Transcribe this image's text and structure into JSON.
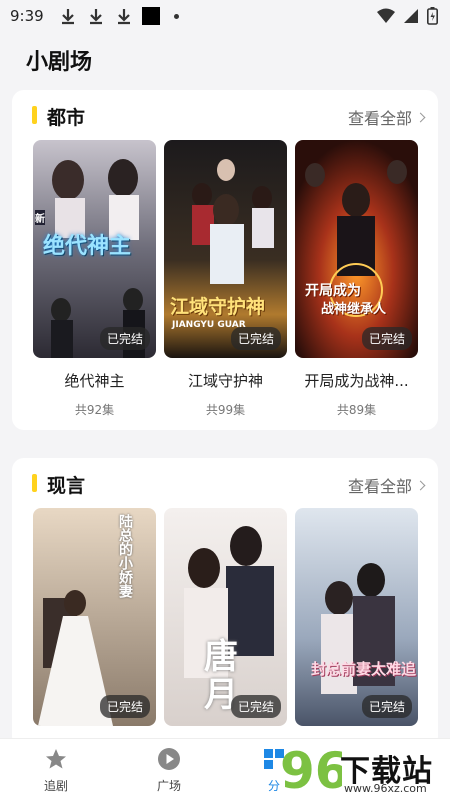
{
  "status_bar": {
    "time": "9:39"
  },
  "page_title": "小剧场",
  "sections": [
    {
      "title": "都市",
      "more_label": "查看全部",
      "cards": [
        {
          "name": "绝代神主",
          "count": "共92集",
          "badge": "已完结",
          "poster_text": "绝代神主",
          "poster_tag": "新"
        },
        {
          "name": "江域守护神",
          "count": "共99集",
          "badge": "已完结",
          "poster_text": "江域守护神",
          "poster_sub": "JIANGYU GUAR"
        },
        {
          "name": "开局成为战神...",
          "count": "共89集",
          "badge": "已完结",
          "poster_text": "开局成为",
          "poster_text2": "战神继承人"
        }
      ]
    },
    {
      "title": "现言",
      "more_label": "查看全部",
      "cards": [
        {
          "name": "",
          "count": "",
          "badge": "已完结",
          "poster_text": "陆总的小娇妻"
        },
        {
          "name": "",
          "count": "",
          "badge": "已完结",
          "poster_text": "唐月"
        },
        {
          "name": "",
          "count": "",
          "badge": "已完结",
          "poster_text": "封总前妻太难追"
        }
      ]
    }
  ],
  "bottom_nav": [
    {
      "label": "追剧",
      "icon": "star-icon"
    },
    {
      "label": "广场",
      "icon": "play-icon"
    },
    {
      "label": "分",
      "icon": "grid-icon"
    }
  ],
  "watermark": {
    "digits": "96",
    "text": "下载站",
    "url": "www.96xz.com"
  },
  "colors": {
    "accent": "#ffd21e",
    "background": "#f4f4f6",
    "card": "#ffffff"
  }
}
